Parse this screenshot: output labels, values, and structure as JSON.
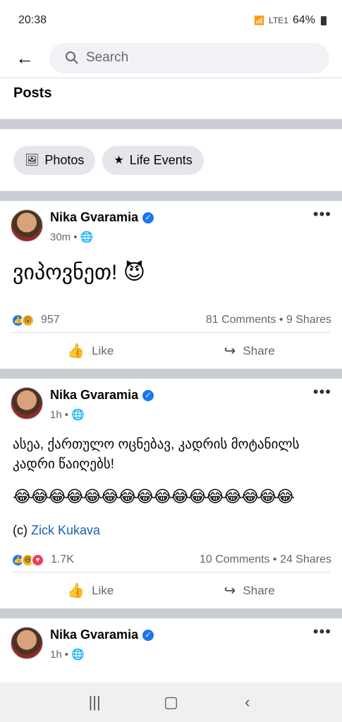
{
  "status": {
    "time": "20:38",
    "network": "LTE1",
    "battery": "64%"
  },
  "search": {
    "placeholder": "Search"
  },
  "section": {
    "title": "Posts"
  },
  "chips": [
    {
      "label": "Photos",
      "icon": "photos-icon"
    },
    {
      "label": "Life Events",
      "icon": "star-flag-icon"
    }
  ],
  "posts": [
    {
      "author": "Nika Gvaramia",
      "time": "30m",
      "text": "ვიპოვნეთ! 😈",
      "reactions": "957",
      "comments": "81 Comments",
      "shares": "9 Shares"
    },
    {
      "author": "Nika Gvaramia",
      "time": "1h",
      "text": "ასეა, ქართულო ოცნებავ, კადრის მოტანილს კადრი წაიღებს!",
      "emojis": "😂😂😂😂😂😂😂😂😂😂😂😂😂😂😂😂",
      "credit_prefix": "(c)",
      "credit_link": "Zick Kukava",
      "reactions": "1.7K",
      "comments": "10 Comments",
      "shares": "24 Shares"
    },
    {
      "author": "Nika Gvaramia",
      "time": "1h"
    }
  ],
  "actions": {
    "like": "Like",
    "share": "Share"
  },
  "separator": "•"
}
